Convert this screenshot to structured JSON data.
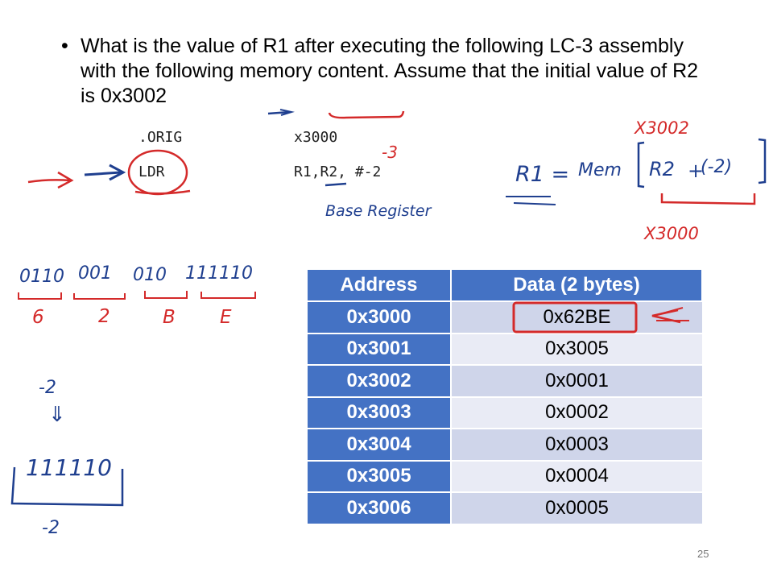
{
  "question": {
    "bullet": "•",
    "text": "What is the value of R1 after executing the following LC-3 assembly with the following memory content. Assume that the initial value of R2 is 0x3002"
  },
  "code": {
    "line1": {
      "op": ".ORIG",
      "operand": "x3000"
    },
    "line2": {
      "op": "LDR",
      "operand": "R1,R2, #-2"
    }
  },
  "table": {
    "headers": [
      "Address",
      "Data (2 bytes)"
    ],
    "rows": [
      {
        "address": "0x3000",
        "data": "0x62BE"
      },
      {
        "address": "0x3001",
        "data": "0x3005"
      },
      {
        "address": "0x3002",
        "data": "0x0001"
      },
      {
        "address": "0x3003",
        "data": "0x0002"
      },
      {
        "address": "0x3004",
        "data": "0x0003"
      },
      {
        "address": "0x3005",
        "data": "0x0004"
      },
      {
        "address": "0x3006",
        "data": "0x0005"
      }
    ]
  },
  "annotations": {
    "base_register": "Base Register",
    "minus3": "-3",
    "formula_r1": "R1 =",
    "formula_mem": "Mem",
    "formula_r2": "R2",
    "formula_plus": "+",
    "formula_neg2": "(-2)",
    "x3002": "X3002",
    "x3000": "X3000",
    "bits": [
      "0110",
      "001",
      "010",
      "111110"
    ],
    "hex_digits": [
      "6",
      "2",
      "B",
      "E"
    ],
    "neg2_top": "-2",
    "down_arrow": "⇓",
    "bits_111110": "111110",
    "neg2_bottom": "-2"
  },
  "colors": {
    "table_header": "#4472C4",
    "row_dark": "#CFD5EA",
    "row_light": "#E9EBF5",
    "ink_blue": "#1f3f8f",
    "ink_red": "#d42a2a"
  },
  "page_number": "25"
}
